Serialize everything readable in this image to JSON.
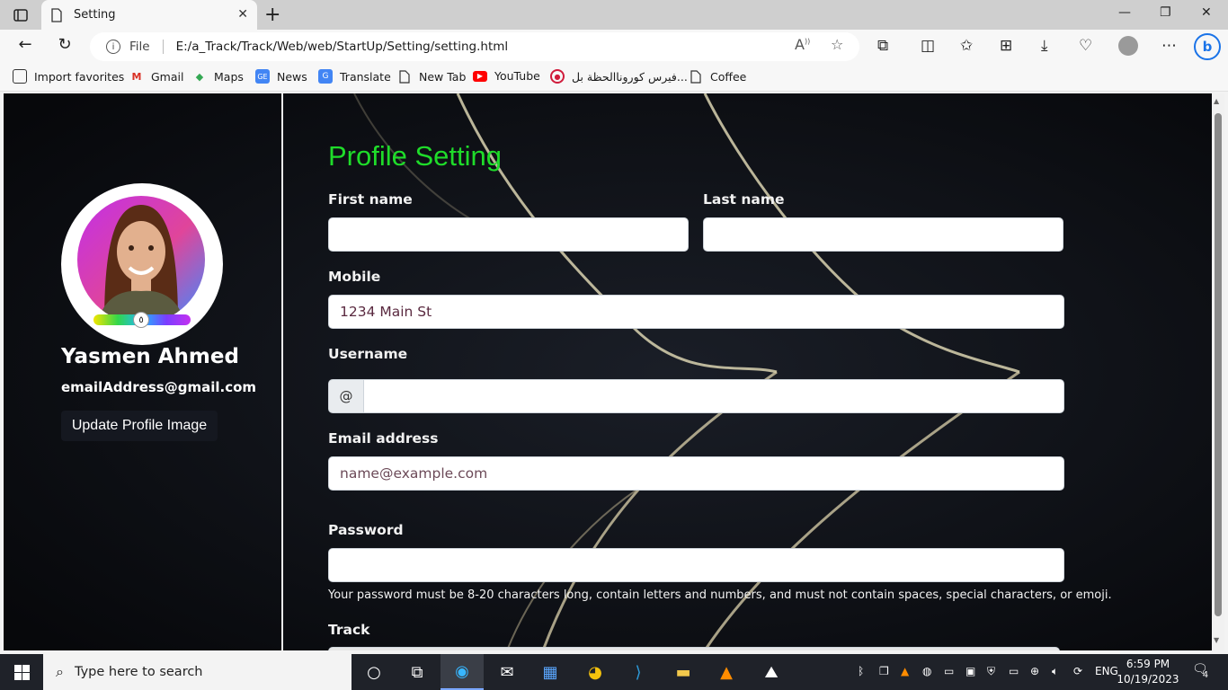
{
  "browser": {
    "tab_title": "Setting",
    "address": "E:/a_Track/Track/Web/web/StartUp/Setting/setting.html",
    "protocol_label": "File",
    "favorites": [
      {
        "label": "Import favorites",
        "icon": "import-icon"
      },
      {
        "label": "Gmail",
        "icon": "gmail-icon"
      },
      {
        "label": "Maps",
        "icon": "maps-icon"
      },
      {
        "label": "News",
        "icon": "news-icon"
      },
      {
        "label": "Translate",
        "icon": "translate-icon"
      },
      {
        "label": "New Tab",
        "icon": "page-icon"
      },
      {
        "label": "YouTube",
        "icon": "youtube-icon"
      },
      {
        "label": "فيرس كوروناالحظة بل...",
        "icon": "target-icon"
      },
      {
        "label": "Coffee",
        "icon": "page-icon"
      }
    ]
  },
  "sidebar": {
    "name": "Yasmen Ahmed",
    "email": "emailAddress@gmail.com",
    "update_button": "Update Profile Image",
    "rating_knob": "٥"
  },
  "form": {
    "title": "Profile Setting",
    "first_name_label": "First name",
    "last_name_label": "Last name",
    "mobile_label": "Mobile",
    "mobile_value": "1234 Main St",
    "username_label": "Username",
    "username_prefix": "@",
    "email_label": "Email address",
    "email_placeholder": "name@example.com",
    "password_label": "Password",
    "password_hint": "Your password must be 8-20 characters long, contain letters and numbers, and must not contain spaces, special characters, or emoji.",
    "track_label": "Track"
  },
  "taskbar": {
    "search_placeholder": "Type here to search",
    "lang": "ENG",
    "time": "6:59 PM",
    "date": "10/19/2023",
    "notifications": "4"
  },
  "colors": {
    "heading": "#1fdc2a",
    "page_bg": "#0b0d12"
  }
}
